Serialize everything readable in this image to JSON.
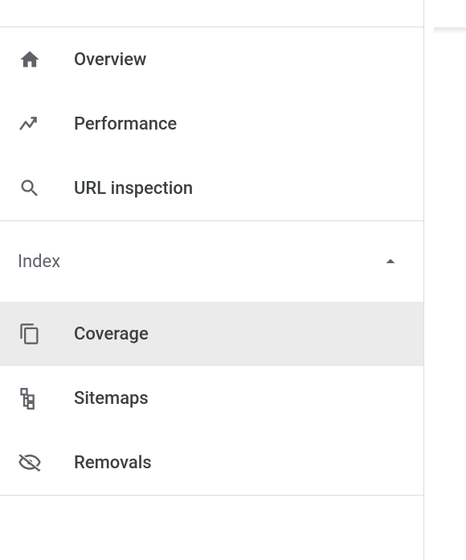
{
  "sidebar": {
    "top": [
      {
        "id": "overview",
        "label": "Overview",
        "icon": "home-icon"
      },
      {
        "id": "performance",
        "label": "Performance",
        "icon": "trend-icon"
      },
      {
        "id": "url-inspection",
        "label": "URL inspection",
        "icon": "search-icon"
      }
    ],
    "sections": [
      {
        "id": "index",
        "title": "Index",
        "expanded": true,
        "items": [
          {
            "id": "coverage",
            "label": "Coverage",
            "icon": "copy-icon",
            "selected": true
          },
          {
            "id": "sitemaps",
            "label": "Sitemaps",
            "icon": "sitemap-icon",
            "selected": false
          },
          {
            "id": "removals",
            "label": "Removals",
            "icon": "hide-icon",
            "selected": false
          }
        ]
      }
    ]
  }
}
